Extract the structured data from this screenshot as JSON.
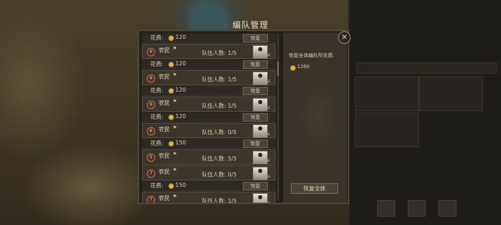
{
  "dialog": {
    "title": "编队管理",
    "close_glyph": "✕",
    "sidebar": {
      "label": "恢复全体编队所花费:",
      "total_cost": "1260",
      "restore_all_label": "恢复全体"
    },
    "rows": [
      {
        "cost_label": "花费:",
        "cost": "120",
        "restore_label": "恢复",
        "squad": {
          "number": "6",
          "unit": "农民",
          "troops": "队伍人数: 1/5"
        }
      },
      {
        "cost_label": "花费:",
        "cost": "120",
        "restore_label": "恢复",
        "squad": {
          "number": "6",
          "unit": "农民",
          "troops": "队伍人数: 1/5"
        }
      },
      {
        "cost_label": "花费:",
        "cost": "120",
        "restore_label": "恢复",
        "squad": {
          "number": "6",
          "unit": "农民",
          "troops": "队伍人数: 1/5"
        }
      },
      {
        "cost_label": "花费:",
        "cost": "120",
        "restore_label": "恢复",
        "squad": {
          "number": "6",
          "unit": "农民",
          "troops": "队伍人数: 0/5"
        }
      },
      {
        "cost_label": "花费:",
        "cost": "150",
        "restore_label": "恢复",
        "squad": {
          "number": "5",
          "unit": "农民",
          "troops": "队伍人数: 5/5"
        }
      },
      {
        "cost_label": null,
        "cost": null,
        "restore_label": null,
        "squad": {
          "number": "7",
          "unit": "农民",
          "troops": "队伍人数: 0/5"
        }
      },
      {
        "cost_label": "花费:",
        "cost": "150",
        "restore_label": "恢复",
        "squad": {
          "number": "7",
          "unit": "农民",
          "troops": "队伍人数: 1/5"
        }
      }
    ]
  },
  "colors": {
    "accent": "#d9b64a",
    "panel": "#231f1b",
    "row": "#3c352c"
  }
}
